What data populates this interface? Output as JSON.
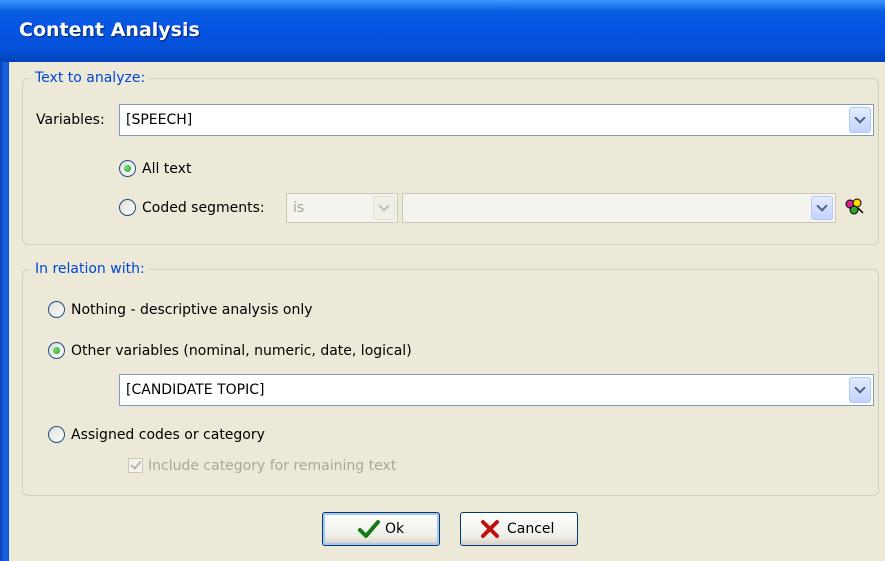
{
  "window": {
    "title": "Content Analysis"
  },
  "text_to_analyze": {
    "legend": "Text to analyze:",
    "variables_label": "Variables:",
    "variables_value": "[SPEECH]",
    "all_text_label": "All text",
    "all_text_checked": true,
    "coded_segments_label": "Coded segments:",
    "coded_segments_checked": false,
    "operator_value": "is",
    "segment_value": ""
  },
  "in_relation_with": {
    "legend": "In relation with:",
    "nothing_label": "Nothing - descriptive analysis only",
    "nothing_checked": false,
    "other_variables_label": "Other variables (nominal, numeric, date, logical)",
    "other_variables_checked": true,
    "other_variables_value": "[CANDIDATE TOPIC]",
    "assigned_codes_label": "Assigned codes or category",
    "assigned_codes_checked": false,
    "include_category_label": "Include category for remaining text",
    "include_category_checked": true
  },
  "buttons": {
    "ok_label": "Ok",
    "cancel_label": "Cancel"
  },
  "icons": {
    "ok": "green-check-icon",
    "cancel": "red-x-icon",
    "segment_picker": "color-code-icon",
    "dropdown": "chevron-down-icon"
  },
  "colors": {
    "legend_text": "#0046d5",
    "title_bar": "#0554e3"
  }
}
